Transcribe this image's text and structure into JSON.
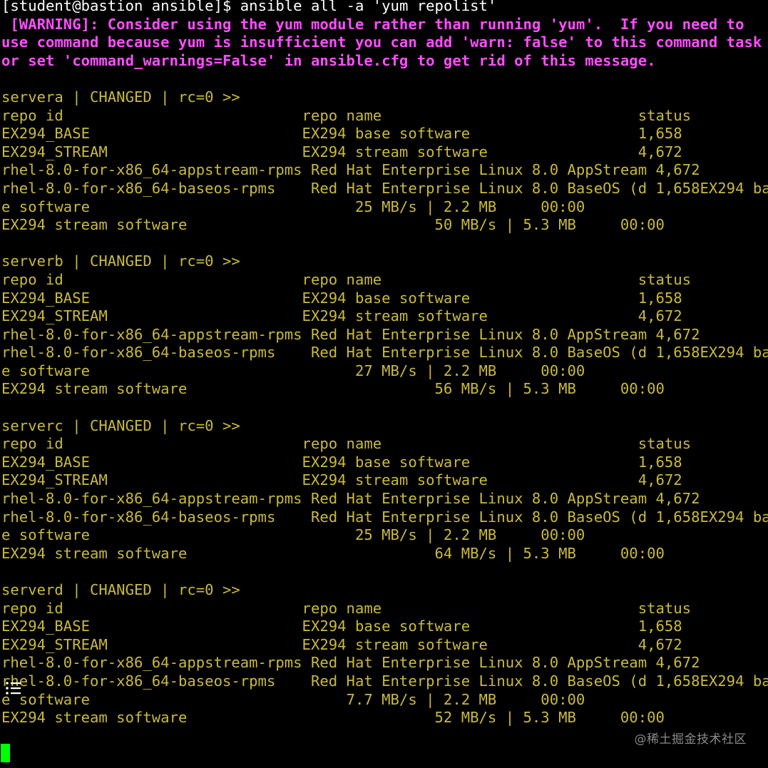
{
  "terminal": {
    "prompt_user_host": "[student@bastion ansible]$",
    "command": "ansible all -a 'yum repolist'",
    "warning_lines": [
      " [WARNING]: Consider using the yum module rather than running 'yum'.  If you need to",
      "use command because yum is insufficient you can add 'warn: false' to this command task",
      "or set 'command_warnings=False' in ansible.cfg to get rid of this message."
    ],
    "hosts": [
      {
        "header": "servera | CHANGED | rc=0 >>",
        "lines": [
          "repo id                           repo name                             status",
          "EX294_BASE                        EX294 base software                   1,658",
          "EX294_STREAM                      EX294 stream software                 4,672",
          "rhel-8.0-for-x86_64-appstream-rpms Red Hat Enterprise Linux 8.0 AppStream 4,672",
          "rhel-8.0-for-x86_64-baseos-rpms    Red Hat Enterprise Linux 8.0 BaseOS (d 1,658EX294 base software",
          "e software                              25 MB/s | 2.2 MB     00:00",
          "EX294 stream software                            50 MB/s | 5.3 MB     00:00"
        ]
      },
      {
        "header": "serverb | CHANGED | rc=0 >>",
        "lines": [
          "repo id                           repo name                             status",
          "EX294_BASE                        EX294 base software                   1,658",
          "EX294_STREAM                      EX294 stream software                 4,672",
          "rhel-8.0-for-x86_64-appstream-rpms Red Hat Enterprise Linux 8.0 AppStream 4,672",
          "rhel-8.0-for-x86_64-baseos-rpms    Red Hat Enterprise Linux 8.0 BaseOS (d 1,658EX294 base software",
          "e software                              27 MB/s | 2.2 MB     00:00",
          "EX294 stream software                            56 MB/s | 5.3 MB     00:00"
        ]
      },
      {
        "header": "serverc | CHANGED | rc=0 >>",
        "lines": [
          "repo id                           repo name                             status",
          "EX294_BASE                        EX294 base software                   1,658",
          "EX294_STREAM                      EX294 stream software                 4,672",
          "rhel-8.0-for-x86_64-appstream-rpms Red Hat Enterprise Linux 8.0 AppStream 4,672",
          "rhel-8.0-for-x86_64-baseos-rpms    Red Hat Enterprise Linux 8.0 BaseOS (d 1,658EX294 base software",
          "e software                              25 MB/s | 2.2 MB     00:00",
          "EX294 stream software                            64 MB/s | 5.3 MB     00:00"
        ]
      },
      {
        "header": "serverd | CHANGED | rc=0 >>",
        "lines": [
          "repo id                           repo name                             status",
          "EX294_BASE                        EX294 base software                   1,658",
          "EX294_STREAM                      EX294 stream software                 4,672",
          "rhel-8.0-for-x86_64-appstream-rpms Red Hat Enterprise Linux 8.0 AppStream 4,672",
          "rhel-8.0-for-x86_64-baseos-rpms    Red Hat Enterprise Linux 8.0 BaseOS (d 1,658EX294 base software",
          "e software                             7.7 MB/s | 2.2 MB     00:00",
          "EX294 stream software                            52 MB/s | 5.3 MB     00:00"
        ]
      }
    ],
    "watermark": "@稀土掘金技术社区",
    "icons": {
      "overlay": "list-icon",
      "cursor": "block-cursor"
    },
    "colors": {
      "background": "#000000",
      "prompt": "#ffffff",
      "warning": "#ff4dff",
      "output": "#c9ba3c",
      "cursor": "#00ff00"
    }
  }
}
